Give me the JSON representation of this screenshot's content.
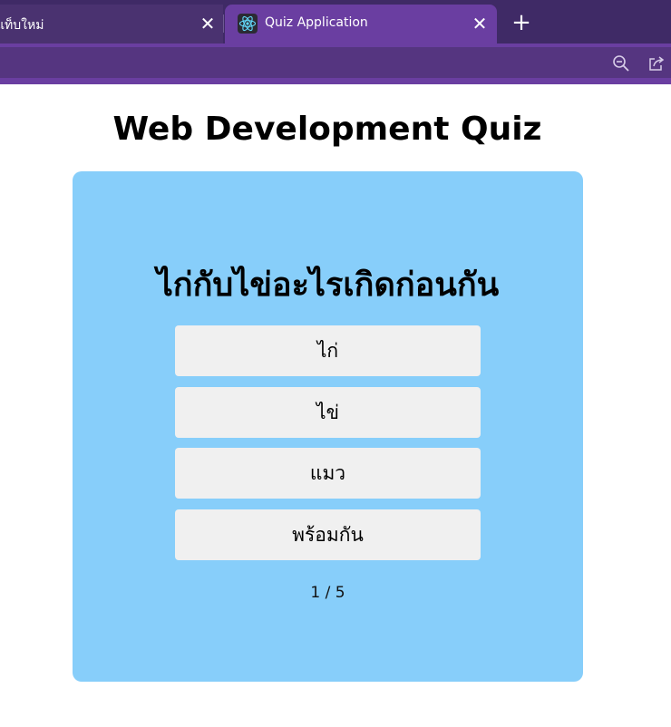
{
  "browser": {
    "tabs": [
      {
        "title": "แท็บใหม่",
        "active": false
      },
      {
        "title": "Quiz Application",
        "active": true
      }
    ],
    "close_glyph": "✕",
    "new_tab_glyph": "+",
    "toolbar_icons": [
      "zoom-out-icon",
      "share-icon"
    ],
    "colors": {
      "tabstrip": "#3f2a66",
      "active_tab": "#6a3ea1",
      "addressbar": "#553580"
    }
  },
  "page": {
    "title": "Web Development Quiz",
    "question": "ไก่กับไข่อะไรเกิดก่อนกัน",
    "answers": [
      "ไก่",
      "ไข่",
      "แมว",
      "พร้อมกัน"
    ],
    "progress": "1 / 5",
    "colors": {
      "card": "#87cefa",
      "answer_bg": "#f0f0f0"
    }
  }
}
